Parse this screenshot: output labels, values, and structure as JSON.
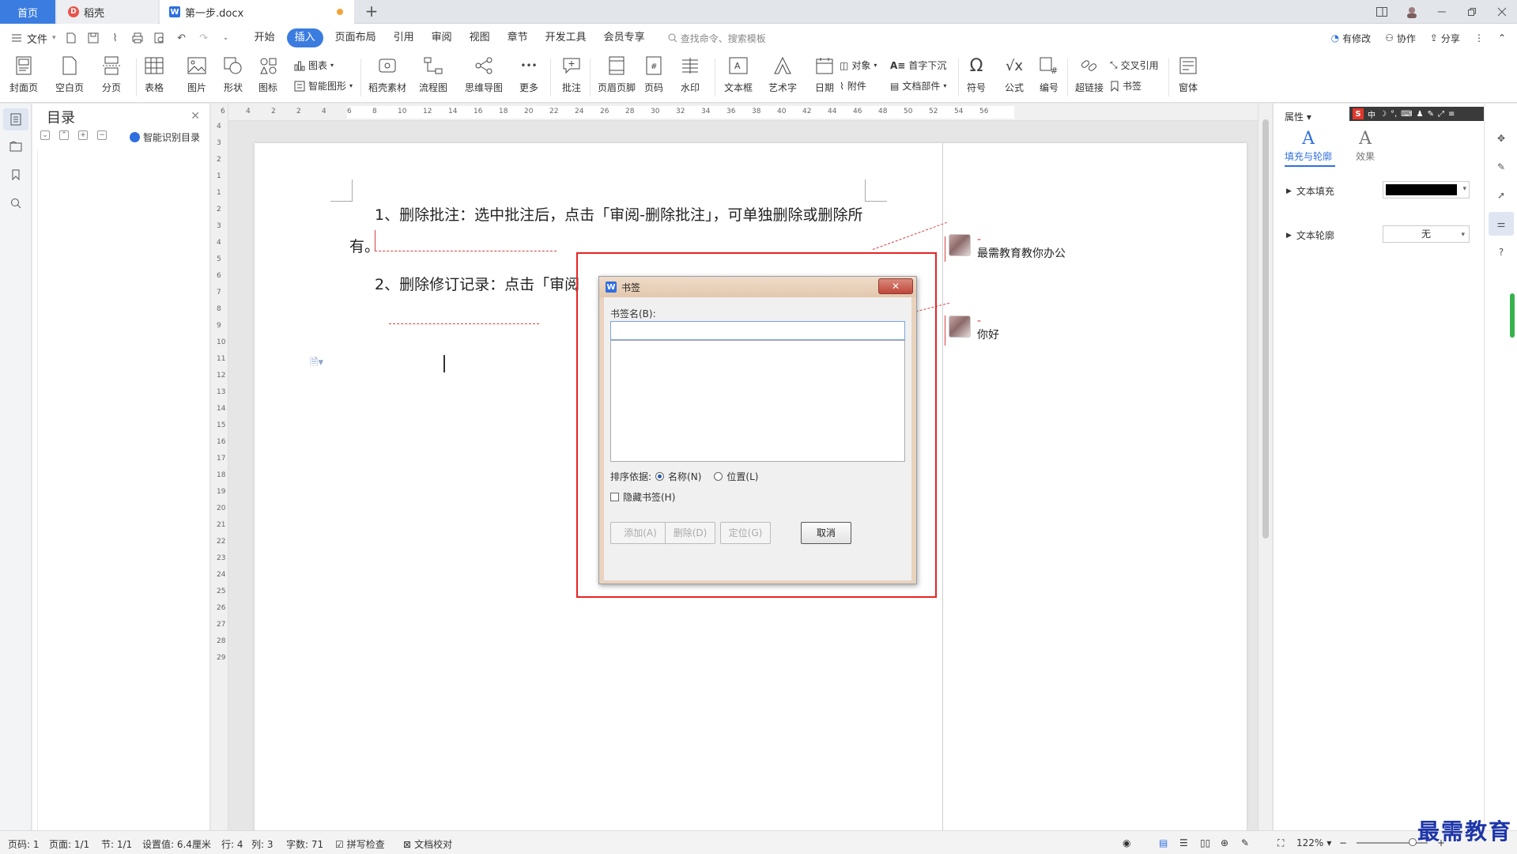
{
  "tabs": {
    "home": "首页",
    "shell": "稻壳",
    "doc": "第一步.docx",
    "add": "+"
  },
  "menu": {
    "file": "文件",
    "tabs": [
      "开始",
      "插入",
      "页面布局",
      "引用",
      "审阅",
      "视图",
      "章节",
      "开发工具",
      "会员专享"
    ],
    "active_tab": "插入",
    "search": "查找命令、搜索模板",
    "revise": "有修改",
    "collab": "协作",
    "share": "分享"
  },
  "ribbon": {
    "cover": "封面页",
    "blank": "空白页",
    "break": "分页",
    "table": "表格",
    "picture": "图片",
    "shape": "形状",
    "icon": "图标",
    "chart": "图表",
    "smartart": "智能图形",
    "material": "稻壳素材",
    "flow": "流程图",
    "mind": "思维导图",
    "more": "更多",
    "comment": "批注",
    "header": "页眉页脚",
    "pagenum": "页码",
    "watermark": "水印",
    "textbox": "文本框",
    "wordart": "艺术字",
    "date": "日期",
    "object": "对象",
    "attach": "附件",
    "dropcap": "首字下沉",
    "docpart": "文档部件",
    "symbol": "符号",
    "formula": "公式",
    "number": "编号",
    "hyperlink": "超链接",
    "crossref": "交叉引用",
    "bookmark": "书签",
    "window": "窗体"
  },
  "toc": {
    "title": "目录",
    "smart": "智能识别目录"
  },
  "ruler": {
    "h_ticks": [
      "6",
      "4",
      "2",
      "2",
      "4",
      "6",
      "8",
      "10",
      "12",
      "14",
      "16",
      "18",
      "20",
      "22",
      "24",
      "26",
      "28",
      "30",
      "32",
      "34",
      "36",
      "38",
      "40",
      "42",
      "44",
      "46",
      "48",
      "50",
      "52",
      "54",
      "56"
    ],
    "v_ticks": [
      "4",
      "3",
      "2",
      "1",
      "1",
      "2",
      "3",
      "4",
      "5",
      "6",
      "7",
      "8",
      "9",
      "10",
      "11",
      "12",
      "13",
      "14",
      "15",
      "16",
      "17",
      "18",
      "19",
      "20",
      "21",
      "22",
      "23",
      "24",
      "25",
      "26",
      "27",
      "28",
      "29"
    ]
  },
  "document": {
    "p1_line1": "1、删除批注：选中批注后，点击「审阅-删除批注」，可单独删除或删除所",
    "p1_line2": "有。",
    "p2": "2、删除修订记录：点击「审阅"
  },
  "comments": [
    {
      "dash": "-",
      "text": "最需教育教你办公"
    },
    {
      "dash": "-",
      "text": "你好"
    }
  ],
  "dialog": {
    "title": "书签",
    "close": "✕",
    "name_label": "书签名(B):",
    "name_value": "",
    "sort_label": "排序依据:",
    "sort_name": "名称(N)",
    "sort_position": "位置(L)",
    "sort_selected": "名称(N)",
    "hide_label": "隐藏书签(H)",
    "hide_checked": false,
    "btn_add": "添加(A)",
    "btn_delete": "删除(D)",
    "btn_goto": "定位(G)",
    "btn_cancel": "取消"
  },
  "props": {
    "title": "属性",
    "tab_fill": "填充与轮廓",
    "tab_effect": "效果",
    "text_fill": "文本填充",
    "text_fill_color": "#000000",
    "text_outline": "文本轮廓",
    "text_outline_value": "无",
    "ime": "中"
  },
  "status": {
    "page": "页码: 1",
    "pages": "页面: 1/1",
    "section": "节: 1/1",
    "setting": "设置值: 6.4厘米",
    "row": "行: 4",
    "col": "列: 3",
    "words": "字数: 71",
    "spell": "拼写检查",
    "proof": "文档校对",
    "zoom": "122%"
  },
  "watermark": "最需教育",
  "colors": {
    "accent": "#3b7ce0",
    "highlight": "#e52424",
    "comment_line": "#d64040"
  }
}
